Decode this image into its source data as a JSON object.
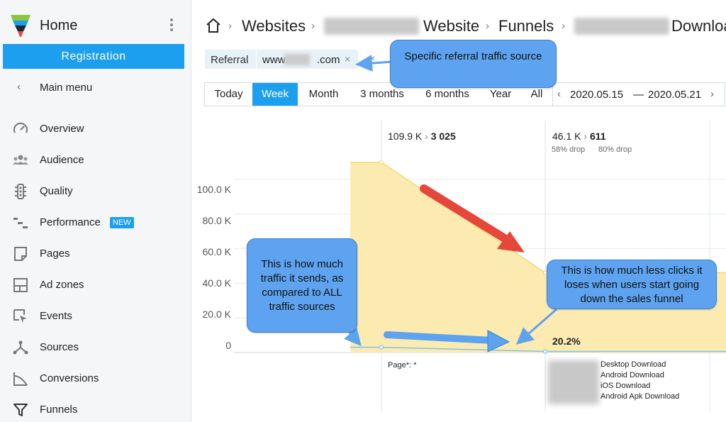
{
  "sidebar": {
    "title": "Home",
    "registration": "Registration",
    "main_menu": "Main menu",
    "items": [
      {
        "label": "Overview",
        "icon": "gauge-icon"
      },
      {
        "label": "Audience",
        "icon": "users-icon"
      },
      {
        "label": "Quality",
        "icon": "traffic-light-icon"
      },
      {
        "label": "Performance",
        "icon": "gantt-icon",
        "badge": "NEW"
      },
      {
        "label": "Pages",
        "icon": "page-icon"
      },
      {
        "label": "Ad zones",
        "icon": "layout-icon"
      },
      {
        "label": "Events",
        "icon": "cursor-icon"
      },
      {
        "label": "Sources",
        "icon": "share-icon"
      },
      {
        "label": "Conversions",
        "icon": "chart-line-icon"
      },
      {
        "label": "Funnels",
        "icon": "funnel-icon"
      }
    ]
  },
  "breadcrumb": {
    "websites": "Websites",
    "website": "Website",
    "funnels": "Funnels",
    "download": "Download"
  },
  "filter": {
    "key": "Referral",
    "value_prefix": "www.",
    "value_suffix": ".com",
    "remove": "×"
  },
  "periods": [
    "Today",
    "Week",
    "Month",
    "3 months",
    "6 months",
    "Year",
    "All"
  ],
  "active_period": "Week",
  "date_range": {
    "from": "2020.05.15",
    "sep": "—",
    "to": "2020.05.21"
  },
  "callouts": {
    "referral": "Specific referral traffic source",
    "traffic": "This is how much traffic it sends, as compared to ALL traffic sources",
    "clicks": "This is how much less clicks it loses when users start going down the sales funnel"
  },
  "colors": {
    "accent": "#1d9ff0",
    "callout": "#5ea3ef",
    "funnel_fill": "#fbe9a8",
    "arrow_red": "#e5473a",
    "arrow_blue": "#5ea3ef"
  },
  "chart_data": {
    "type": "area",
    "ylim": [
      0,
      110000
    ],
    "y_ticks": [
      "100.0 K",
      "80.0 K",
      "60.0 K",
      "40.0 K",
      "20.0 K",
      "0"
    ],
    "y_tick_values": [
      100000,
      80000,
      60000,
      40000,
      20000,
      0
    ],
    "steps": [
      {
        "all_total": "109.9 K",
        "segment": "3 025",
        "all_value": 109900,
        "segment_value": 3025,
        "label": "Page*: *"
      },
      {
        "all_total": "46.1 K",
        "segment": "611",
        "all_value": 46100,
        "segment_value": 611,
        "all_drop": "58% drop",
        "segment_drop": "80% drop",
        "conversion": "20.2%",
        "labels": [
          "Desktop Download",
          "Android Download",
          "iOS Download",
          "Android Apk Download"
        ]
      }
    ]
  }
}
